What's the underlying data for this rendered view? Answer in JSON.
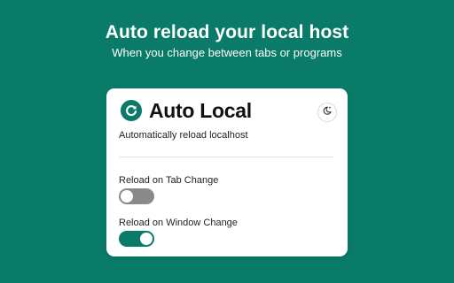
{
  "hero": {
    "title": "Auto reload your local host",
    "subtitle": "When you change between tabs or programs"
  },
  "card": {
    "brand_name": "Auto Local",
    "brand_icon": "reload-icon",
    "theme_icon": "moon-stars-icon",
    "description": "Automatically reload localhost",
    "settings": [
      {
        "label": "Reload on Tab Change",
        "enabled": false
      },
      {
        "label": "Reload on Window Change",
        "enabled": true
      }
    ]
  },
  "colors": {
    "background": "#0a7a69",
    "accent": "#0a7a69",
    "toggle_off": "#8a8a8a",
    "card": "#ffffff"
  }
}
